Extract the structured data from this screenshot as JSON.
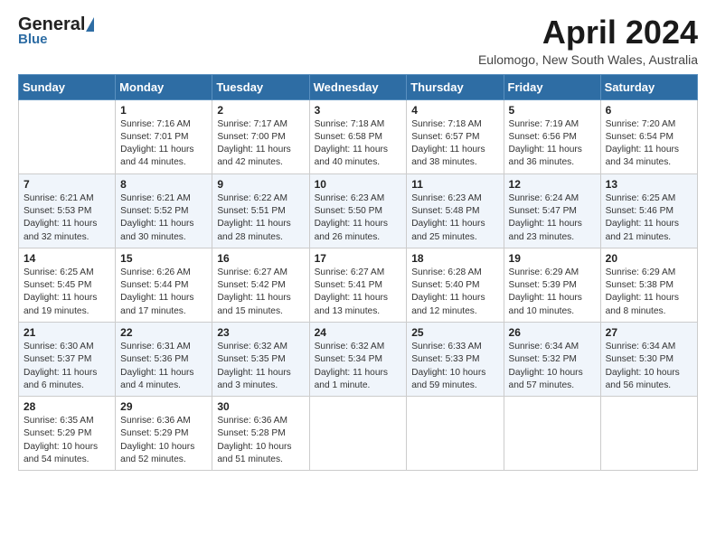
{
  "header": {
    "logo_line1": "General",
    "logo_triangle": true,
    "logo_sub": "Blue",
    "month_title": "April 2024",
    "location": "Eulomogo, New South Wales, Australia"
  },
  "days_of_week": [
    "Sunday",
    "Monday",
    "Tuesday",
    "Wednesday",
    "Thursday",
    "Friday",
    "Saturday"
  ],
  "weeks": [
    [
      {
        "day": "",
        "content": ""
      },
      {
        "day": "1",
        "content": "Sunrise: 7:16 AM\nSunset: 7:01 PM\nDaylight: 11 hours\nand 44 minutes."
      },
      {
        "day": "2",
        "content": "Sunrise: 7:17 AM\nSunset: 7:00 PM\nDaylight: 11 hours\nand 42 minutes."
      },
      {
        "day": "3",
        "content": "Sunrise: 7:18 AM\nSunset: 6:58 PM\nDaylight: 11 hours\nand 40 minutes."
      },
      {
        "day": "4",
        "content": "Sunrise: 7:18 AM\nSunset: 6:57 PM\nDaylight: 11 hours\nand 38 minutes."
      },
      {
        "day": "5",
        "content": "Sunrise: 7:19 AM\nSunset: 6:56 PM\nDaylight: 11 hours\nand 36 minutes."
      },
      {
        "day": "6",
        "content": "Sunrise: 7:20 AM\nSunset: 6:54 PM\nDaylight: 11 hours\nand 34 minutes."
      }
    ],
    [
      {
        "day": "7",
        "content": "Sunrise: 6:21 AM\nSunset: 5:53 PM\nDaylight: 11 hours\nand 32 minutes."
      },
      {
        "day": "8",
        "content": "Sunrise: 6:21 AM\nSunset: 5:52 PM\nDaylight: 11 hours\nand 30 minutes."
      },
      {
        "day": "9",
        "content": "Sunrise: 6:22 AM\nSunset: 5:51 PM\nDaylight: 11 hours\nand 28 minutes."
      },
      {
        "day": "10",
        "content": "Sunrise: 6:23 AM\nSunset: 5:50 PM\nDaylight: 11 hours\nand 26 minutes."
      },
      {
        "day": "11",
        "content": "Sunrise: 6:23 AM\nSunset: 5:48 PM\nDaylight: 11 hours\nand 25 minutes."
      },
      {
        "day": "12",
        "content": "Sunrise: 6:24 AM\nSunset: 5:47 PM\nDaylight: 11 hours\nand 23 minutes."
      },
      {
        "day": "13",
        "content": "Sunrise: 6:25 AM\nSunset: 5:46 PM\nDaylight: 11 hours\nand 21 minutes."
      }
    ],
    [
      {
        "day": "14",
        "content": "Sunrise: 6:25 AM\nSunset: 5:45 PM\nDaylight: 11 hours\nand 19 minutes."
      },
      {
        "day": "15",
        "content": "Sunrise: 6:26 AM\nSunset: 5:44 PM\nDaylight: 11 hours\nand 17 minutes."
      },
      {
        "day": "16",
        "content": "Sunrise: 6:27 AM\nSunset: 5:42 PM\nDaylight: 11 hours\nand 15 minutes."
      },
      {
        "day": "17",
        "content": "Sunrise: 6:27 AM\nSunset: 5:41 PM\nDaylight: 11 hours\nand 13 minutes."
      },
      {
        "day": "18",
        "content": "Sunrise: 6:28 AM\nSunset: 5:40 PM\nDaylight: 11 hours\nand 12 minutes."
      },
      {
        "day": "19",
        "content": "Sunrise: 6:29 AM\nSunset: 5:39 PM\nDaylight: 11 hours\nand 10 minutes."
      },
      {
        "day": "20",
        "content": "Sunrise: 6:29 AM\nSunset: 5:38 PM\nDaylight: 11 hours\nand 8 minutes."
      }
    ],
    [
      {
        "day": "21",
        "content": "Sunrise: 6:30 AM\nSunset: 5:37 PM\nDaylight: 11 hours\nand 6 minutes."
      },
      {
        "day": "22",
        "content": "Sunrise: 6:31 AM\nSunset: 5:36 PM\nDaylight: 11 hours\nand 4 minutes."
      },
      {
        "day": "23",
        "content": "Sunrise: 6:32 AM\nSunset: 5:35 PM\nDaylight: 11 hours\nand 3 minutes."
      },
      {
        "day": "24",
        "content": "Sunrise: 6:32 AM\nSunset: 5:34 PM\nDaylight: 11 hours\nand 1 minute."
      },
      {
        "day": "25",
        "content": "Sunrise: 6:33 AM\nSunset: 5:33 PM\nDaylight: 10 hours\nand 59 minutes."
      },
      {
        "day": "26",
        "content": "Sunrise: 6:34 AM\nSunset: 5:32 PM\nDaylight: 10 hours\nand 57 minutes."
      },
      {
        "day": "27",
        "content": "Sunrise: 6:34 AM\nSunset: 5:30 PM\nDaylight: 10 hours\nand 56 minutes."
      }
    ],
    [
      {
        "day": "28",
        "content": "Sunrise: 6:35 AM\nSunset: 5:29 PM\nDaylight: 10 hours\nand 54 minutes."
      },
      {
        "day": "29",
        "content": "Sunrise: 6:36 AM\nSunset: 5:29 PM\nDaylight: 10 hours\nand 52 minutes."
      },
      {
        "day": "30",
        "content": "Sunrise: 6:36 AM\nSunset: 5:28 PM\nDaylight: 10 hours\nand 51 minutes."
      },
      {
        "day": "",
        "content": ""
      },
      {
        "day": "",
        "content": ""
      },
      {
        "day": "",
        "content": ""
      },
      {
        "day": "",
        "content": ""
      }
    ]
  ]
}
